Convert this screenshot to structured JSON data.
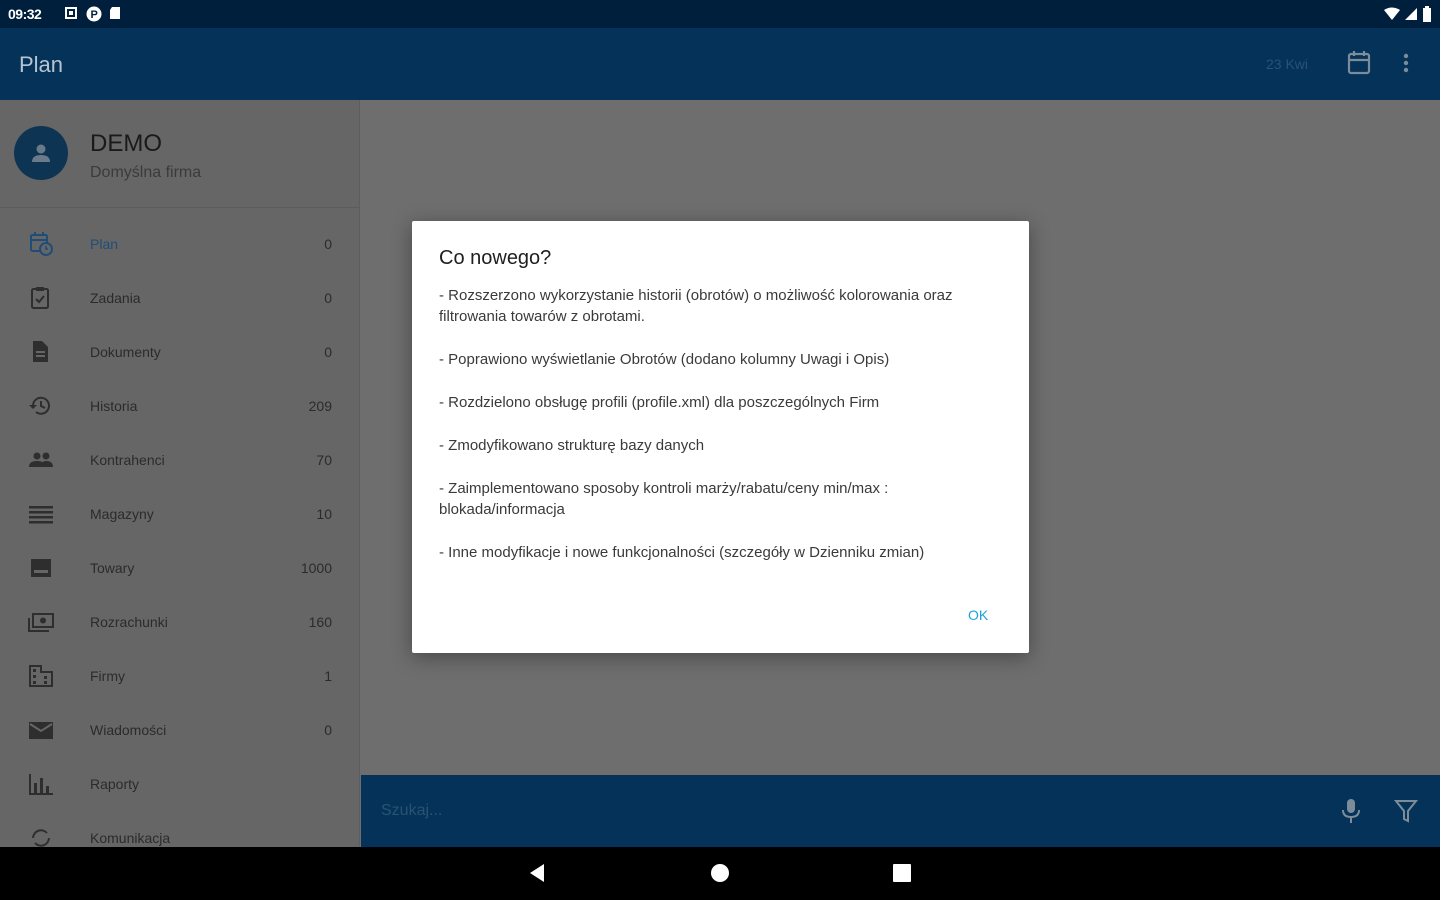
{
  "status_bar": {
    "time": "09:32"
  },
  "app_bar": {
    "title": "Plan",
    "date": "23 Kwi"
  },
  "drawer": {
    "user_name": "DEMO",
    "company": "Domyślna firma",
    "items": [
      {
        "label": "Plan",
        "count": "0",
        "icon": "calendar-clock-icon",
        "active": true
      },
      {
        "label": "Zadania",
        "count": "0",
        "icon": "clipboard-check-icon"
      },
      {
        "label": "Dokumenty",
        "count": "0",
        "icon": "document-icon"
      },
      {
        "label": "Historia",
        "count": "209",
        "icon": "history-icon"
      },
      {
        "label": "Kontrahenci",
        "count": "70",
        "icon": "people-icon"
      },
      {
        "label": "Magazyny",
        "count": "10",
        "icon": "list-icon"
      },
      {
        "label": "Towary",
        "count": "1000",
        "icon": "product-icon"
      },
      {
        "label": "Rozrachunki",
        "count": "160",
        "icon": "money-icon"
      },
      {
        "label": "Firmy",
        "count": "1",
        "icon": "building-icon"
      },
      {
        "label": "Wiadomości",
        "count": "0",
        "icon": "mail-icon"
      },
      {
        "label": "Raporty",
        "count": "",
        "icon": "bar-chart-icon"
      },
      {
        "label": "Komunikacja",
        "count": "",
        "icon": "sync-icon"
      }
    ]
  },
  "search": {
    "placeholder": "Szukaj..."
  },
  "dialog": {
    "title": "Co nowego?",
    "paragraphs": [
      "- Rozszerzono wykorzystanie historii (obrotów) o możliwość kolorowania oraz filtrowania towarów z obrotami.",
      " - Poprawiono wyświetlanie Obrotów (dodano kolumny Uwagi i Opis)",
      " - Rozdzielono obsługę profili (profile.xml) dla poszczególnych Firm",
      " - Zmodyfikowano strukturę bazy danych",
      " - Zaimplementowano sposoby kontroli marży/rabatu/ceny min/max : blokada/informacja",
      " - Inne modyfikacje i nowe funkcjonalności (szczegóły w Dzienniku zmian)"
    ],
    "ok_label": "OK"
  },
  "colors": {
    "primary": "#043259",
    "status": "#001f3d",
    "accent": "#1ea3d8",
    "scrim": "#6e6e6e"
  }
}
